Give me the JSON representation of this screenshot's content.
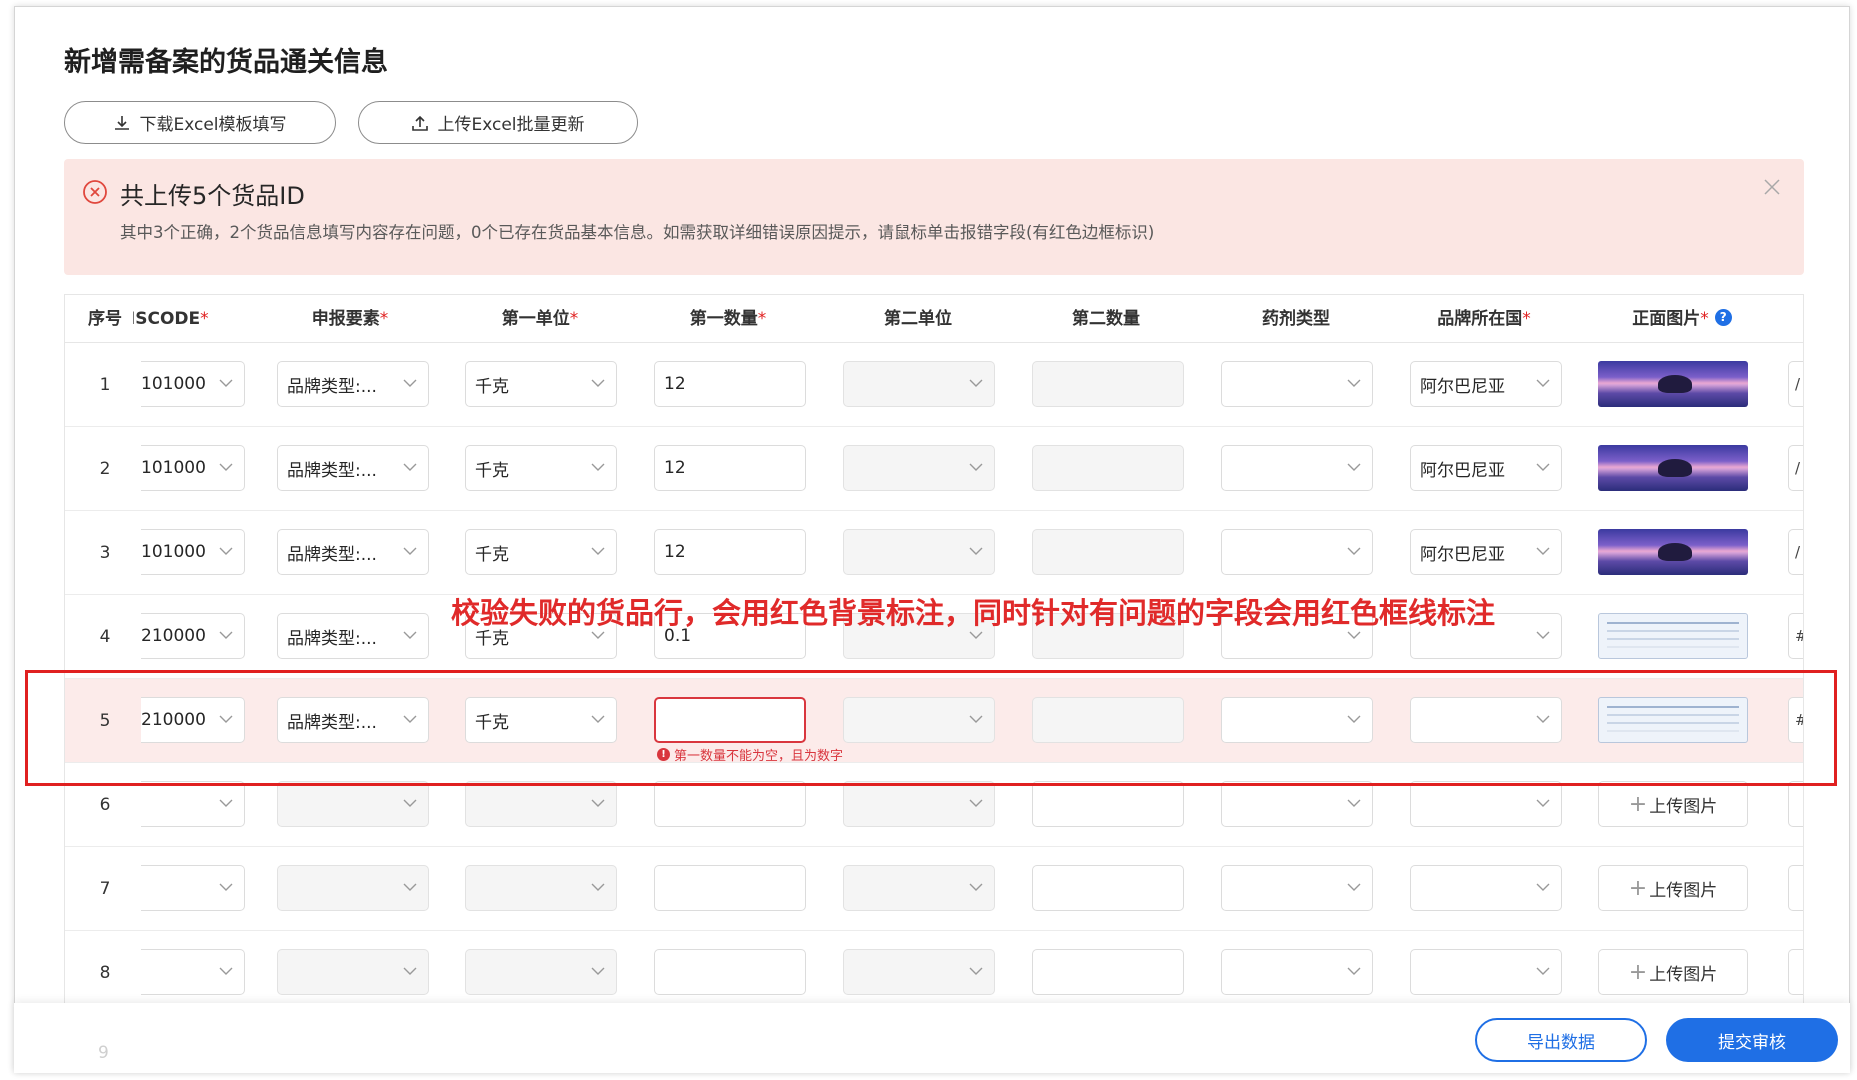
{
  "page": {
    "title": "新增需备案的货品通关信息",
    "download_button": "下载Excel模板填写",
    "upload_button": "上传Excel批量更新"
  },
  "alert": {
    "title": "共上传5个货品ID",
    "description": "其中3个正确，2个货品信息填写内容存在问题，0个已存在货品基本信息。如需获取详细错误原因提示，请鼠标单击报错字段(有红色边框标识)"
  },
  "table": {
    "columns": {
      "index": "序号",
      "hscode": "HSCODE",
      "declaration": "申报要素",
      "unit1": "第一单位",
      "qty1": "第一数量",
      "unit2": "第二单位",
      "qty2": "第二数量",
      "drug_type": "药剂类型",
      "brand_country": "品牌所在国",
      "front_image": "正面图片"
    },
    "required_mark": "*",
    "rows": [
      {
        "index": "1",
        "hscode": "101000",
        "declaration": "品牌类型:...",
        "unit1": "千克",
        "qty1": "12",
        "brand_country": "阿尔巴尼亚",
        "edge": "/"
      },
      {
        "index": "2",
        "hscode": "101000",
        "declaration": "品牌类型:...",
        "unit1": "千克",
        "qty1": "12",
        "brand_country": "阿尔巴尼亚",
        "edge": "/"
      },
      {
        "index": "3",
        "hscode": "101000",
        "declaration": "品牌类型:...",
        "unit1": "千克",
        "qty1": "12",
        "brand_country": "阿尔巴尼亚",
        "edge": "/"
      },
      {
        "index": "4",
        "hscode": "210000",
        "declaration": "品牌类型:...",
        "unit1": "千克",
        "qty1": "0.1",
        "brand_country": "",
        "edge": "#"
      },
      {
        "index": "5",
        "hscode": "210000",
        "declaration": "品牌类型:...",
        "unit1": "千克",
        "qty1": "",
        "brand_country": "",
        "edge": "#",
        "error": "第一数量不能为空，且为数字"
      },
      {
        "index": "6",
        "upload_label": "上传图片"
      },
      {
        "index": "7",
        "upload_label": "上传图片"
      },
      {
        "index": "8",
        "upload_label": "上传图片"
      }
    ],
    "ghost_row_index": "9"
  },
  "annotation": "校验失败的货品行，会用红色背景标注，同时针对有问题的字段会用红色框线标注",
  "footer": {
    "export_button": "导出数据",
    "submit_button": "提交审核"
  },
  "colors": {
    "accent": "#1f6fe5",
    "error": "#d9363e",
    "alert_bg": "#fbe6e3",
    "error_row_bg": "#fcebea"
  }
}
